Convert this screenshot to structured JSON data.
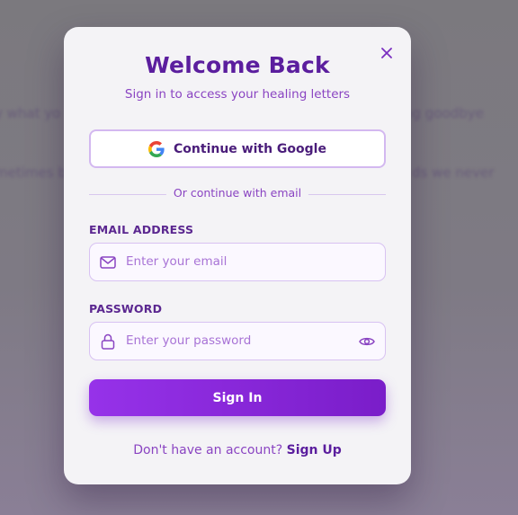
{
  "background": {
    "text_left_1": "y what yo",
    "text_right_1": "ng goodbye",
    "text_left_2": "metimes b",
    "text_right_2": "ds we never"
  },
  "modal": {
    "title": "Welcome Back",
    "subtitle": "Sign in to access your healing letters",
    "close_icon": "close-icon",
    "google_button_label": "Continue with Google",
    "divider_text": "Or continue with email",
    "email": {
      "label": "EMAIL ADDRESS",
      "placeholder": "Enter your email",
      "value": "",
      "icon": "mail-icon"
    },
    "password": {
      "label": "PASSWORD",
      "placeholder": "Enter your password",
      "value": "",
      "icon": "lock-icon",
      "toggle_icon": "eye-icon"
    },
    "signin_label": "Sign In",
    "footer_prompt": "Don't have an account? ",
    "signup_label": "Sign Up"
  },
  "colors": {
    "title": "#5b1e9e",
    "accent": "#8a44c2",
    "button_start": "#9632e9",
    "button_end": "#7a1dc9",
    "modal_bg": "#f4f3f6"
  }
}
